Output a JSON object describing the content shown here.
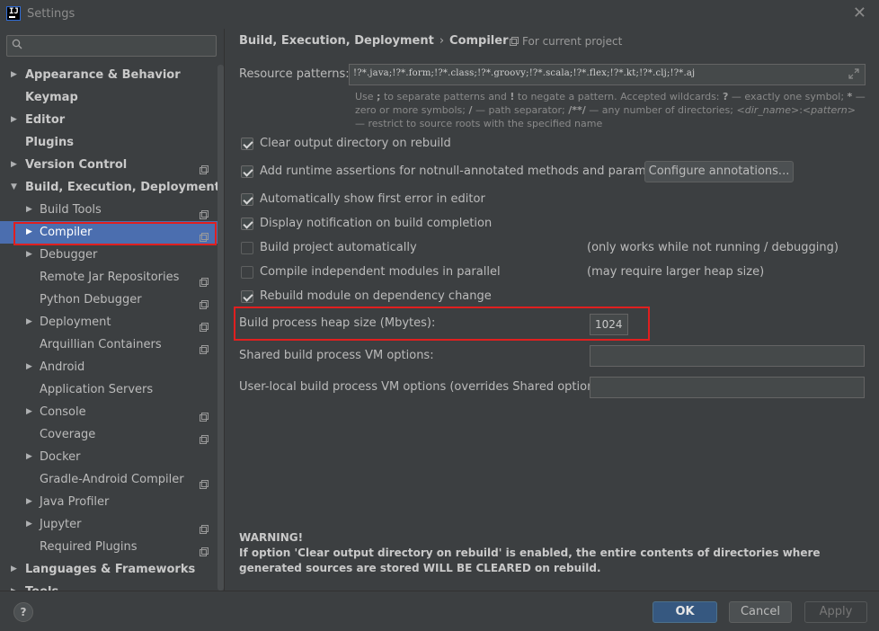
{
  "window": {
    "title": "Settings"
  },
  "search": {
    "placeholder": ""
  },
  "sidebar": {
    "items": [
      {
        "label": "Appearance & Behavior",
        "level": 0,
        "expandable": true,
        "expanded": false,
        "project": false
      },
      {
        "label": "Keymap",
        "level": 0,
        "expandable": false,
        "project": false
      },
      {
        "label": "Editor",
        "level": 0,
        "expandable": true,
        "expanded": false,
        "project": false
      },
      {
        "label": "Plugins",
        "level": 0,
        "expandable": false,
        "project": false
      },
      {
        "label": "Version Control",
        "level": 0,
        "expandable": true,
        "expanded": false,
        "project": true
      },
      {
        "label": "Build, Execution, Deployment",
        "level": 0,
        "expandable": true,
        "expanded": true,
        "project": false
      },
      {
        "label": "Build Tools",
        "level": 1,
        "expandable": true,
        "expanded": false,
        "project": true
      },
      {
        "label": "Compiler",
        "level": 1,
        "expandable": true,
        "expanded": false,
        "project": true,
        "selected": true
      },
      {
        "label": "Debugger",
        "level": 1,
        "expandable": true,
        "expanded": false,
        "project": false
      },
      {
        "label": "Remote Jar Repositories",
        "level": 1,
        "expandable": false,
        "project": true
      },
      {
        "label": "Python Debugger",
        "level": 1,
        "expandable": false,
        "project": true
      },
      {
        "label": "Deployment",
        "level": 1,
        "expandable": true,
        "expanded": false,
        "project": true
      },
      {
        "label": "Arquillian Containers",
        "level": 1,
        "expandable": false,
        "project": true
      },
      {
        "label": "Android",
        "level": 1,
        "expandable": true,
        "expanded": false,
        "project": false
      },
      {
        "label": "Application Servers",
        "level": 1,
        "expandable": false,
        "project": false
      },
      {
        "label": "Console",
        "level": 1,
        "expandable": true,
        "expanded": false,
        "project": true
      },
      {
        "label": "Coverage",
        "level": 1,
        "expandable": false,
        "project": true
      },
      {
        "label": "Docker",
        "level": 1,
        "expandable": true,
        "expanded": false,
        "project": false
      },
      {
        "label": "Gradle-Android Compiler",
        "level": 1,
        "expandable": false,
        "project": true
      },
      {
        "label": "Java Profiler",
        "level": 1,
        "expandable": true,
        "expanded": false,
        "project": false
      },
      {
        "label": "Jupyter",
        "level": 1,
        "expandable": true,
        "expanded": false,
        "project": true
      },
      {
        "label": "Required Plugins",
        "level": 1,
        "expandable": false,
        "project": true
      },
      {
        "label": "Languages & Frameworks",
        "level": 0,
        "expandable": true,
        "expanded": false,
        "project": false
      },
      {
        "label": "Tools",
        "level": 0,
        "expandable": true,
        "expanded": false,
        "project": false
      }
    ]
  },
  "breadcrumb": {
    "parent": "Build, Execution, Deployment",
    "current": "Compiler",
    "scope": "For current project"
  },
  "resource_patterns": {
    "label": "Resource patterns:",
    "value": "!?*.java;!?*.form;!?*.class;!?*.groovy;!?*.scala;!?*.flex;!?*.kt;!?*.clj;!?*.aj",
    "hint": {
      "p1": "Use ",
      "semi": ";",
      "p2": " to separate patterns and ",
      "bang": "!",
      "p3": " to negate a pattern. Accepted wildcards: ",
      "q": "?",
      "p4": " — exactly one symbol; ",
      "star": "*",
      "p5": " — zero or more symbols; ",
      "slash": "/",
      "p6": " — path separator; ",
      "dstar": "/**/",
      "p7": " — any number of directories; ",
      "dirname": "<dir_name>",
      "colon": ":",
      "pattern": "<pattern>",
      "p8": " — restrict to source roots with the specified name"
    }
  },
  "options": [
    {
      "label": "Clear output directory on rebuild",
      "checked": true,
      "note": ""
    },
    {
      "label": "Add runtime assertions for notnull-annotated methods and parameters",
      "checked": true,
      "note": ""
    },
    {
      "label": "Automatically show first error in editor",
      "checked": true,
      "note": ""
    },
    {
      "label": "Display notification on build completion",
      "checked": true,
      "note": ""
    },
    {
      "label": "Build project automatically",
      "checked": false,
      "note": "(only works while not running / debugging)"
    },
    {
      "label": "Compile independent modules in parallel",
      "checked": false,
      "note": "(may require larger heap size)"
    },
    {
      "label": "Rebuild module on dependency change",
      "checked": true,
      "note": ""
    }
  ],
  "configure_button": {
    "label": "Configure annotations..."
  },
  "heap": {
    "label": "Build process heap size (Mbytes):",
    "value": "1024"
  },
  "shared_vm": {
    "label": "Shared build process VM options:",
    "value": ""
  },
  "user_vm": {
    "label": "User-local build process VM options (overrides Shared options):",
    "value": ""
  },
  "warning": {
    "title": "WARNING!",
    "body": "If option 'Clear output directory on rebuild' is enabled, the entire contents of directories where generated sources are stored WILL BE CLEARED on rebuild."
  },
  "footer": {
    "help": "?",
    "ok": "OK",
    "cancel": "Cancel",
    "apply": "Apply"
  },
  "colors": {
    "background": "#3c3f41",
    "selection": "#4b6eaf",
    "highlight_outline": "#e01f1f",
    "ok_button": "#365880"
  }
}
